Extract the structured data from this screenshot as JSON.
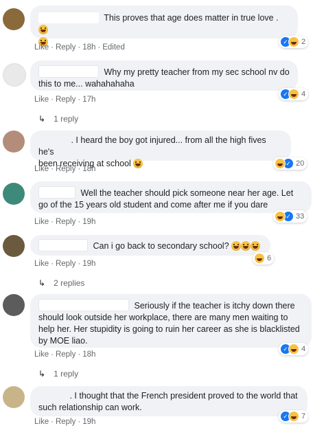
{
  "comments": [
    {
      "text": "This proves that age does matter in true love .",
      "actions": {
        "like": "Like",
        "reply": "Reply",
        "time": "18h",
        "extra": "Edited"
      },
      "reactions": {
        "count": "2"
      }
    },
    {
      "text_line1": "Why my pretty teacher from my sec school nv do",
      "text_line2": "this to me... wahahahaha",
      "actions": {
        "like": "Like",
        "reply": "Reply",
        "time": "17h"
      },
      "reactions": {
        "count": "4"
      },
      "replies": "1 reply"
    },
    {
      "text_line1": ". I heard the boy got injured... from all the high fives he's",
      "text_line2": "been receiving at school",
      "actions": {
        "like": "Like",
        "reply": "Reply",
        "time": "18h"
      },
      "reactions": {
        "count": "20"
      }
    },
    {
      "text_line1": "Well the teacher should pick someone near her age. Let",
      "text_line2": "go of the 15 years old student and come after me if you dare",
      "actions": {
        "like": "Like",
        "reply": "Reply",
        "time": "19h"
      },
      "reactions": {
        "count": "33"
      }
    },
    {
      "text": "Can i go back to secondary school?",
      "actions": {
        "like": "Like",
        "reply": "Reply",
        "time": "19h"
      },
      "reactions": {
        "count": "6"
      },
      "replies": "2 replies"
    },
    {
      "text_line1": "Seriously if the teacher is itchy down there",
      "text_line2": "should look outside her workplace, there are many men waiting to",
      "text_line3": "help her. Her stupidity is going to ruin her career as she is blacklisted",
      "text_line4": "by MOE liao.",
      "actions": {
        "like": "Like",
        "reply": "Reply",
        "time": "18h"
      },
      "reactions": {
        "count": "4"
      },
      "replies": "1 reply"
    },
    {
      "text_line1": ". I thought that the French president proved to the world that",
      "text_line2": "such relationship can work.",
      "actions": {
        "like": "Like",
        "reply": "Reply",
        "time": "19h"
      },
      "reactions": {
        "count": "7"
      }
    }
  ],
  "icons": {
    "reply_arrow": "↳",
    "like_glyph": "👍"
  },
  "colors": {
    "bubble": "#f0f2f5",
    "like_blue": "#1877f2",
    "meta_gray": "#65676b"
  }
}
